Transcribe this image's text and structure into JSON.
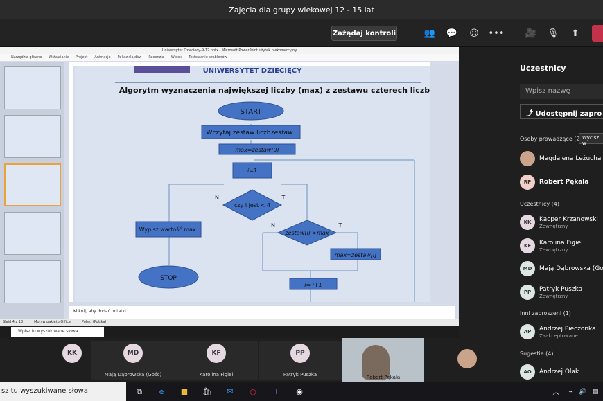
{
  "window": {
    "title": "Zajęcia dla grupy wiekowej 12 - 15 lat"
  },
  "toolbar": {
    "request_control": "Zażądaj kontroli"
  },
  "ppt": {
    "title": "Uniwersytet Dzieciecy-9-12.pptx - Microsoft PowerPoint użytek niekomercyjny",
    "tabs": [
      "Narzędzia główne",
      "Wstawianie",
      "Projekt",
      "Animacje",
      "Pokaz slajdów",
      "Recenzja",
      "Widok",
      "Testowanie szablonów"
    ],
    "notes_placeholder": "Kliknij, aby dodać notatki",
    "status": [
      "Slajd 4 z 13",
      "Motyw pakietu Office",
      "Polski (Polska)"
    ],
    "search_placeholder": "Wpisz tu wyszukiwane słowa"
  },
  "slide": {
    "header": "UNIWERSYTET DZIECIĘCY",
    "heading": "Algorytm wyznaczenia największej liczby (max) z zestawu czterech liczb",
    "start": "START",
    "read": "Wczytaj zestaw liczb",
    "read_var": "zestaw",
    "assign_max": "max=zestaw[0]",
    "init_i": "i=1",
    "cond1": "czy i jest < 4",
    "no1": "N",
    "yes1": "T",
    "output": "Wypisz wartość max:",
    "stop": "STOP",
    "cond2": "zestaw[i] >max",
    "no2": "N",
    "yes2": "T",
    "update_max": "max=zestaw[i]",
    "increment": "i= i+1"
  },
  "strip": {
    "tiles": [
      {
        "initials": "KK",
        "name": ""
      },
      {
        "initials": "MD",
        "name": "Mają Dąbrowska (Gość)"
      },
      {
        "initials": "KF",
        "name": "Karolina Figiel"
      },
      {
        "initials": "PP",
        "name": "Patryk Puszka"
      }
    ],
    "video_name": "Robert Pękala"
  },
  "panel": {
    "title": "Uczestnicy",
    "search_placeholder": "Wpisz nazwę",
    "share_invite": "Udostępnij zapro",
    "presenters_label": "Osoby prowadzące (2)",
    "remove_all": "Wycisz w",
    "presenters": [
      {
        "initials": "",
        "name": "Magdalena Leżucha"
      },
      {
        "initials": "RP",
        "name": "Robert Pękala"
      }
    ],
    "attendees_label": "Uczestnicy (4)",
    "attendees": [
      {
        "initials": "KK",
        "name": "Kacper Krzanowski",
        "sub": "Zewnętrzny"
      },
      {
        "initials": "KF",
        "name": "Karolina Figiel",
        "sub": "Zewnętrzny"
      },
      {
        "initials": "MD",
        "name": "Mają Dąbrowska (Gość",
        "sub": ""
      },
      {
        "initials": "PP",
        "name": "Patryk Puszka",
        "sub": "Zewnętrzny"
      }
    ],
    "invited_label": "Inni zaproszeni (1)",
    "invited": [
      {
        "initials": "AP",
        "name": "Andrzej Pieczonka",
        "sub": "Zaakceptowane"
      }
    ],
    "suggestions_label": "Sugestie (4)",
    "suggestions": [
      {
        "initials": "AO",
        "name": "Andrzej Olak"
      }
    ]
  },
  "taskbar": {
    "search_placeholder": "sz tu wyszukiwane słowa"
  },
  "colors": {
    "accent": "#6264a7",
    "leave": "#c4314b",
    "shape": "#4472c4"
  }
}
